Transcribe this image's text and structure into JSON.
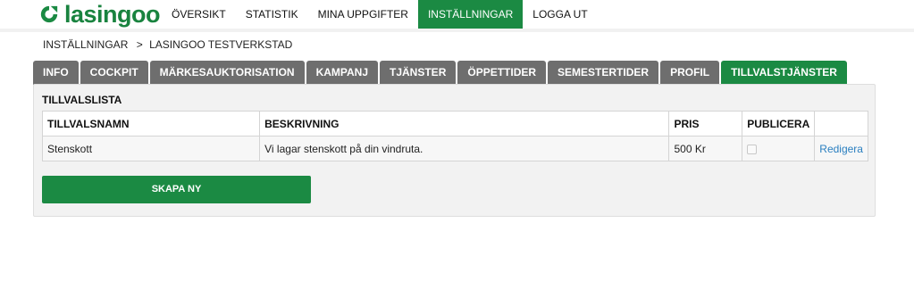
{
  "brand": {
    "name": "lasingoo",
    "color": "#1b8a43"
  },
  "nav": {
    "items": [
      {
        "label": "ÖVERSIKT"
      },
      {
        "label": "STATISTIK"
      },
      {
        "label": "MINA UPPGIFTER"
      },
      {
        "label": "INSTÄLLNINGAR",
        "active": true
      },
      {
        "label": "LOGGA UT"
      }
    ]
  },
  "breadcrumb": {
    "parent": "INSTÄLLNINGAR",
    "separator": ">",
    "current": "LASINGOO TESTVERKSTAD"
  },
  "tabs": [
    {
      "label": "INFO"
    },
    {
      "label": "COCKPIT"
    },
    {
      "label": "MÄRKESAUKTORISATION"
    },
    {
      "label": "KAMPANJ"
    },
    {
      "label": "TJÄNSTER"
    },
    {
      "label": "ÖPPETTIDER"
    },
    {
      "label": "SEMESTERTIDER"
    },
    {
      "label": "PROFIL"
    },
    {
      "label": "TILLVALSTJÄNSTER",
      "active": true
    }
  ],
  "panel": {
    "title": "TILLVALSLISTA",
    "columns": {
      "name": "TILLVALSNAMN",
      "description": "BESKRIVNING",
      "price": "PRIS",
      "publish": "PUBLICERA"
    },
    "rows": [
      {
        "name": "Stenskott",
        "description": "Vi lagar stenskott på din vindruta.",
        "price": "500 Kr",
        "published": false,
        "edit_label": "Redigera"
      }
    ],
    "create_button": "SKAPA NY"
  }
}
